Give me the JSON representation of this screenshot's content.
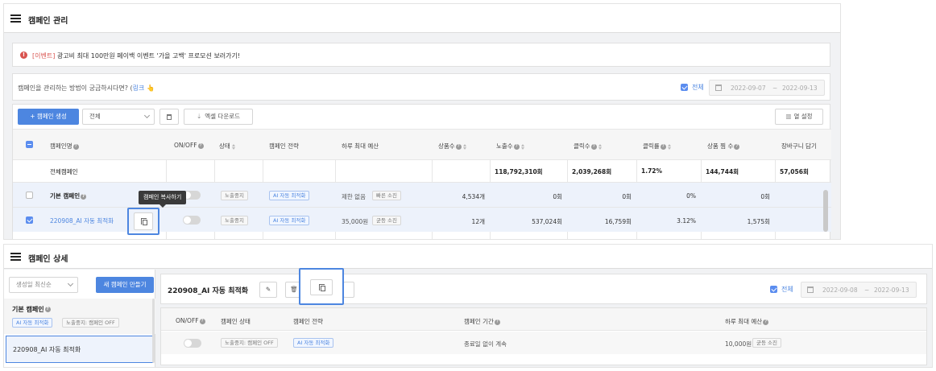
{
  "top": {
    "title": "캠페인 관리",
    "event": {
      "tag": "[이벤트]",
      "text": "광고비 최대 100만원 페이백 이벤트 '가을 고백' 프로모션 보러가기!"
    },
    "guide": {
      "text": "캠페인을 관리하는 방법이 궁금하시다면? (",
      "link": "링크",
      "hand": "👆",
      "close": ")"
    },
    "filter": {
      "all_label": "전체",
      "date_start": "2022-09-07",
      "date_sep": "~",
      "date_end": "2022-09-13"
    },
    "toolbar": {
      "create_label": "+ 캠페인 생성",
      "select_value": "전체",
      "excel_label": "엑셀 다운로드",
      "column_label": "열 설정"
    },
    "table": {
      "headers": {
        "name": "캠페인명",
        "onoff": "ON/OFF",
        "status": "상태",
        "strategy": "캠페인 전략",
        "budget": "하루 최대 예산",
        "products": "상품수",
        "impressions": "노출수",
        "clicks": "클릭수",
        "ctr": "클릭률",
        "pageviews": "상품 찜 수",
        "cart": "장바구니 담기"
      },
      "total": {
        "name": "전체캠페인",
        "impressions": "118,792,310회",
        "clicks": "2,039,268회",
        "ctr": "1.72%",
        "pageviews": "144,744회",
        "cart": "57,056회"
      },
      "rows": [
        {
          "name": "기본 캠페인",
          "status": "노출중지",
          "strategy": "AI 자동 최적화",
          "budget": "제한 없음",
          "budget_tag": "빠른 소진",
          "products": "4,534개",
          "impressions": "0회",
          "clicks": "0회",
          "ctr": "0%",
          "pageviews": "0회"
        },
        {
          "name": "220908_AI 자동 최적화",
          "status": "노출중지",
          "strategy": "AI 자동 최적화",
          "budget": "35,000원",
          "budget_tag": "균등 소진",
          "products": "12개",
          "impressions": "537,024회",
          "clicks": "16,759회",
          "ctr": "3.12%",
          "pageviews": "1,575회"
        }
      ]
    },
    "tooltip": "캠페인 복사하기"
  },
  "bottom": {
    "title": "캠페인 상세",
    "sort_value": "생성일 최신순",
    "new_label": "새 캠페인 만들기",
    "list": [
      {
        "name": "기본 캠페인",
        "tags": [
          "AI 자동 최적화",
          "노출중지: 캠페인 OFF"
        ]
      },
      {
        "name": "220908_AI 자동 최적화"
      }
    ],
    "detail": {
      "name": "220908_AI 자동 최적화",
      "all_label": "전체",
      "date_start": "2022-09-08",
      "date_sep": "~",
      "date_end": "2022-09-13",
      "headers": {
        "onoff": "ON/OFF",
        "status": "캠페인 상태",
        "strategy": "캠페인 전략",
        "period": "캠페인 기간",
        "budget": "하루 최대 예산"
      },
      "row": {
        "status": "노출중지: 캠페인 OFF",
        "strategy": "AI 자동 최적화",
        "period": "종료일 없이 계속",
        "budget": "10,000원",
        "budget_tag": "균등 소진"
      }
    }
  }
}
